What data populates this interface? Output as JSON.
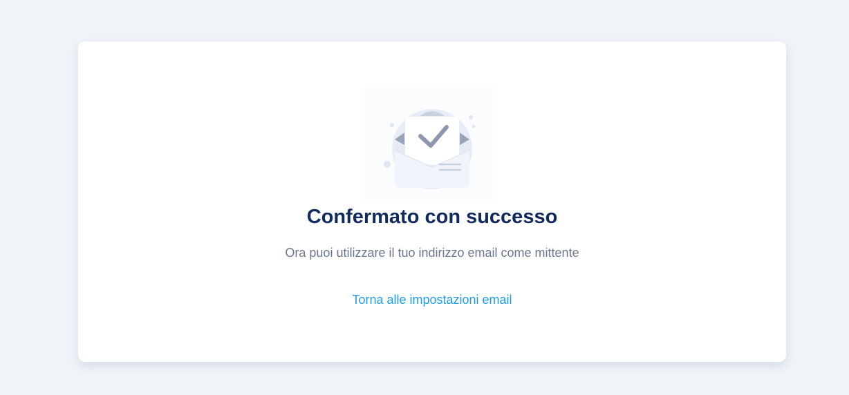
{
  "confirmation": {
    "title": "Confermato con successo",
    "message": "Ora puoi utilizzare il tuo indirizzo email come mittente",
    "back_link_label": "Torna alle impostazioni email",
    "illustration_icon": "envelope-check-icon"
  },
  "colors": {
    "page_background": "#f0f3f8",
    "card_background": "#ffffff",
    "title": "#132a5c",
    "message": "#6b778f",
    "link": "#1f9ce8"
  }
}
